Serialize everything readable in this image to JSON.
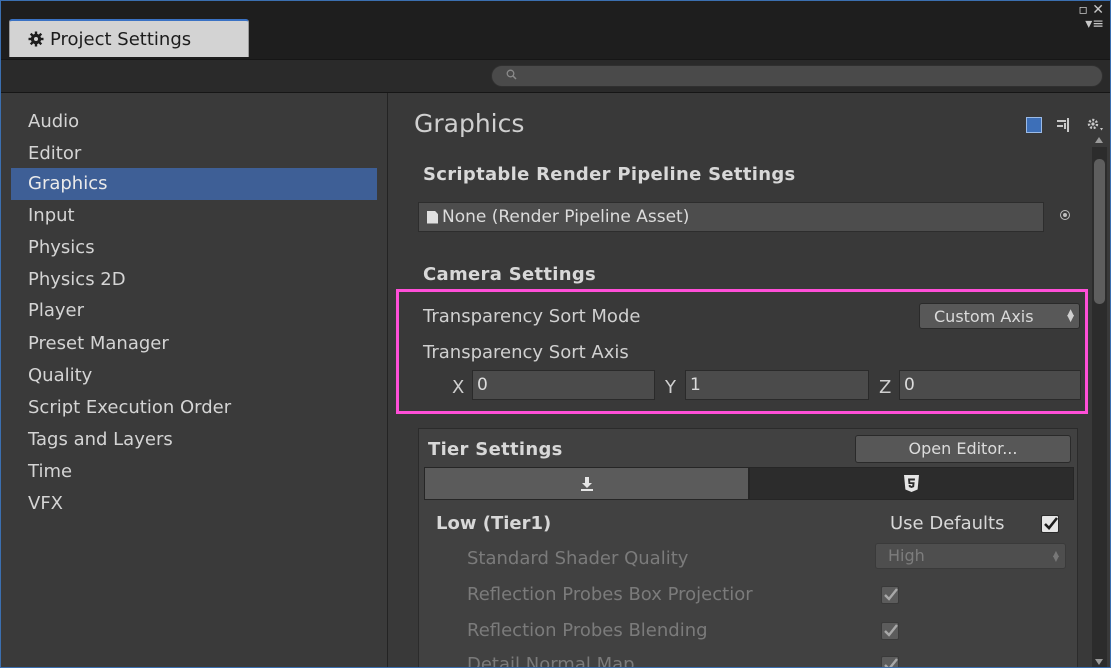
{
  "window": {
    "tab_title": "Project Settings"
  },
  "search": {
    "placeholder": ""
  },
  "sidebar": {
    "items": [
      {
        "label": "Audio"
      },
      {
        "label": "Editor"
      },
      {
        "label": "Graphics",
        "active": true
      },
      {
        "label": "Input"
      },
      {
        "label": "Physics"
      },
      {
        "label": "Physics 2D"
      },
      {
        "label": "Player"
      },
      {
        "label": "Preset Manager"
      },
      {
        "label": "Quality"
      },
      {
        "label": "Script Execution Order"
      },
      {
        "label": "Tags and Layers"
      },
      {
        "label": "Time"
      },
      {
        "label": "VFX"
      }
    ]
  },
  "main": {
    "title": "Graphics",
    "srp": {
      "section_title": "Scriptable Render Pipeline Settings",
      "asset_value": "None (Render Pipeline Asset)"
    },
    "camera": {
      "section_title": "Camera Settings",
      "sort_mode_label": "Transparency Sort Mode",
      "sort_mode_value": "Custom Axis",
      "sort_axis_label": "Transparency Sort Axis",
      "axis": {
        "x_label": "X",
        "x_value": "0",
        "y_label": "Y",
        "y_value": "1",
        "z_label": "Z",
        "z_value": "0"
      }
    },
    "tier": {
      "section_title": "Tier Settings",
      "open_editor_label": "Open Editor...",
      "tier_name": "Low (Tier1)",
      "use_defaults_label": "Use Defaults",
      "use_defaults_checked": true,
      "rows": [
        {
          "label": "Standard Shader Quality",
          "value": "High"
        },
        {
          "label": "Reflection Probes Box Projectior",
          "checked": true
        },
        {
          "label": "Reflection Probes Blending",
          "checked": true
        },
        {
          "label": "Detail Normal Map",
          "checked": true
        }
      ]
    }
  },
  "colors": {
    "accent_selection": "#3e5f96",
    "highlight_border": "#ff4fd8",
    "tab_accent": "#3a72c4"
  }
}
